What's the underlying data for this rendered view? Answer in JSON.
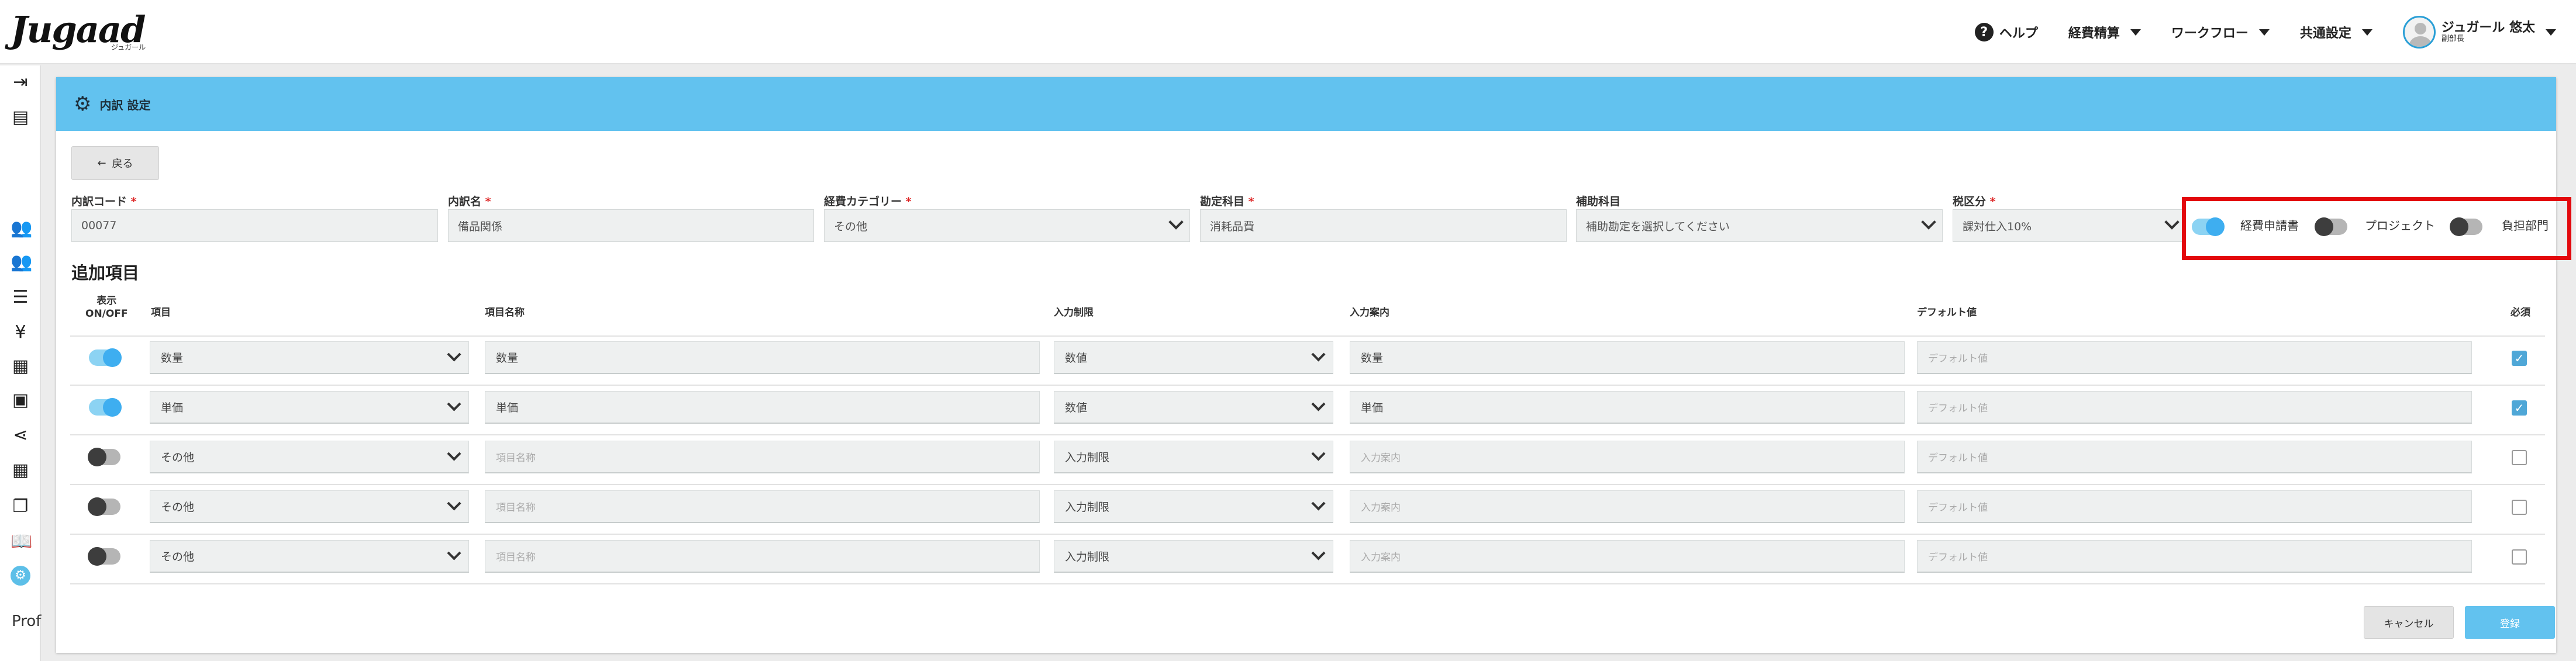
{
  "brand": {
    "logo": "Jugaad",
    "logo_sub": "ジュガール"
  },
  "header": {
    "help": "ヘルプ",
    "menus": [
      "経費精算",
      "ワークフロー",
      "共通設定"
    ],
    "user_name": "ジュガール 悠太",
    "user_role": "副部長"
  },
  "sidebar": {
    "icons": [
      "collapse-menu-icon",
      "building-icon",
      "users-icon",
      "user-group-icon",
      "list-icon",
      "yen-icon",
      "document-icon",
      "receipt-icon",
      "share-icon",
      "table-icon",
      "copy-icon",
      "book-icon",
      "active-settings-icon"
    ],
    "prof_label": "Prof"
  },
  "page": {
    "title": "内訳 設定",
    "back_label": "戻る"
  },
  "form": {
    "fields": [
      {
        "label": "内訳コード",
        "required": true,
        "value": "00077",
        "select": false
      },
      {
        "label": "内訳名",
        "required": true,
        "value": "備品関係",
        "select": false
      },
      {
        "label": "経費カテゴリー",
        "required": true,
        "value": "その他",
        "select": true
      },
      {
        "label": "勘定科目",
        "required": true,
        "value": "消耗品費",
        "select": false
      },
      {
        "label": "補助科目",
        "required": false,
        "value": "補助勘定を選択してください",
        "select": true
      },
      {
        "label": "税区分",
        "required": true,
        "value": "課対仕入10%",
        "select": true
      }
    ],
    "toggles": [
      {
        "label": "経費申請書",
        "on": true
      },
      {
        "label": "プロジェクト",
        "on": false
      },
      {
        "label": "負担部門",
        "on": false
      }
    ]
  },
  "additional": {
    "title": "追加項目",
    "headers": {
      "onoff": "表示\nON/OFF",
      "item": "項目",
      "item_name": "項目名称",
      "input_limit": "入力制限",
      "input_guide": "入力案内",
      "default_value": "デフォルト値",
      "required": "必須"
    },
    "rows": [
      {
        "on": true,
        "item": "数量",
        "name": "数量",
        "name_placeholder": false,
        "limit": "数値",
        "guide": "数量",
        "guide_placeholder": false,
        "default": "デフォルト値",
        "required": true
      },
      {
        "on": true,
        "item": "単価",
        "name": "単価",
        "name_placeholder": false,
        "limit": "数値",
        "guide": "単価",
        "guide_placeholder": false,
        "default": "デフォルト値",
        "required": true
      },
      {
        "on": false,
        "item": "その他",
        "name": "項目名称",
        "name_placeholder": true,
        "limit": "入力制限",
        "guide": "入力案内",
        "guide_placeholder": true,
        "default": "デフォルト値",
        "required": false
      },
      {
        "on": false,
        "item": "その他",
        "name": "項目名称",
        "name_placeholder": true,
        "limit": "入力制限",
        "guide": "入力案内",
        "guide_placeholder": true,
        "default": "デフォルト値",
        "required": false
      },
      {
        "on": false,
        "item": "その他",
        "name": "項目名称",
        "name_placeholder": true,
        "limit": "入力制限",
        "guide": "入力案内",
        "guide_placeholder": true,
        "default": "デフォルト値",
        "required": false
      }
    ]
  },
  "actions": {
    "cancel": "キャンセル",
    "save": "登録"
  },
  "colors": {
    "header_bg": "#62c2ef",
    "accent": "#3eaef0",
    "highlight": "#e3080d"
  }
}
